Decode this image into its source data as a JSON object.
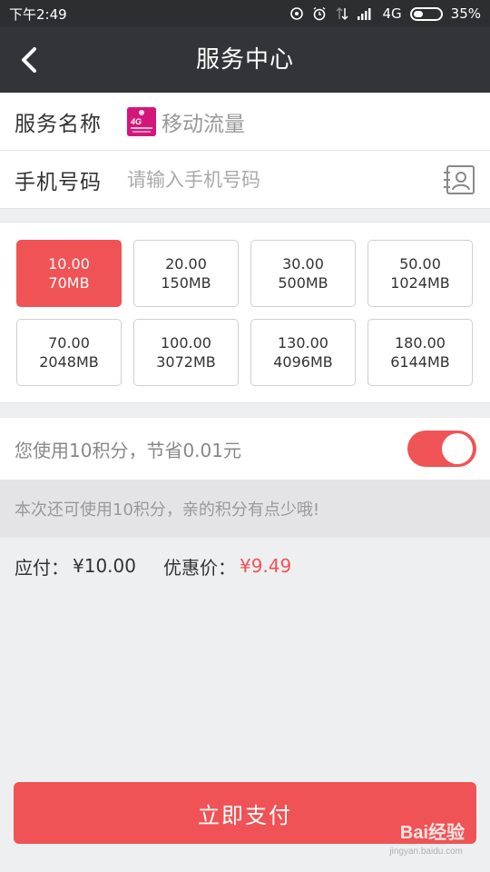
{
  "status_bar": {
    "time": "下午2:49",
    "network": "4G",
    "battery": "35%",
    "battery_level": 0.35
  },
  "nav": {
    "title": "服务中心",
    "back_icon": "chevron-left-icon"
  },
  "form": {
    "service_label": "服务名称",
    "service_value": "移动流量",
    "phone_label": "手机号码",
    "phone_placeholder": "请输入手机号码",
    "phone_value": "",
    "contact_icon": "contact-book-icon"
  },
  "packages": [
    {
      "price": "10.00",
      "data": "70MB",
      "selected": true
    },
    {
      "price": "20.00",
      "data": "150MB",
      "selected": false
    },
    {
      "price": "30.00",
      "data": "500MB",
      "selected": false
    },
    {
      "price": "50.00",
      "data": "1024MB",
      "selected": false
    },
    {
      "price": "70.00",
      "data": "2048MB",
      "selected": false
    },
    {
      "price": "100.00",
      "data": "3072MB",
      "selected": false
    },
    {
      "price": "130.00",
      "data": "4096MB",
      "selected": false
    },
    {
      "price": "180.00",
      "data": "6144MB",
      "selected": false
    }
  ],
  "points": {
    "text": "您使用10积分，节省0.01元",
    "toggle_on": true,
    "hint": "本次还可使用10积分，亲的积分有点少哦!"
  },
  "totals": {
    "payable_label": "应付：",
    "payable_value": "¥10.00",
    "discount_label": "优惠价：",
    "discount_value": "¥9.49"
  },
  "pay_button": {
    "label": "立即支付"
  },
  "watermark": {
    "text": "Bai经验",
    "sub": "jingyan.baidu.com"
  },
  "colors": {
    "accent": "#f05355",
    "nav_bg": "#333437",
    "status_bg": "#2d2e30",
    "page_bg": "#eeeff1"
  }
}
